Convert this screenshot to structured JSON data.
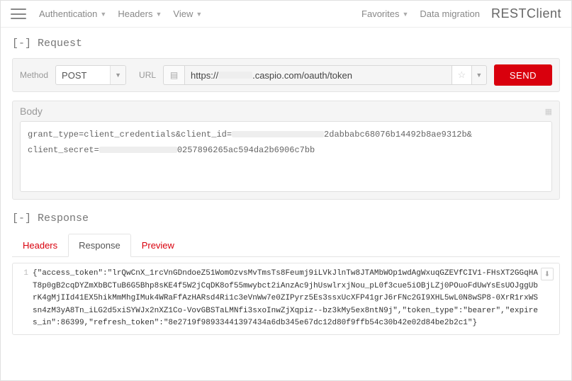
{
  "topbar": {
    "menu": {
      "auth": "Authentication",
      "headers": "Headers",
      "view": "View"
    },
    "favorites": "Favorites",
    "migration": "Data migration",
    "brand": "RESTClient"
  },
  "request": {
    "header": "[-] Request",
    "method_label": "Method",
    "method": "POST",
    "url_label": "URL",
    "url_prefix": "https://",
    "url_suffix": ".caspio.com/oauth/token",
    "send": "SEND"
  },
  "body": {
    "label": "Body",
    "line1a": "grant_type=client_credentials&client_id=",
    "line1b": "2dabbabc68076b14492b8ae9312b&",
    "line2a": "client_secret=",
    "line2b": "0257896265ac594da2b6906c7bb"
  },
  "response": {
    "header": "[-] Response",
    "tabs": {
      "headers": "Headers",
      "response": "Response",
      "preview": "Preview"
    },
    "line_no": "1",
    "body": "{\"access_token\":\"lrQwCnX_1rcVnGDndoeZ51WomOzvsMvTmsTs8Feumj9iLVkJlnTw8JTAMbWOp1wdAgWxuqGZEVfCIV1-FHsXT2GGqHAT8p0gB2cqDYZmXbBCTuB6G5Bhp8sKE4f5W2jCqDK8of55mwybct2iAnzAc9jhUswlrxjNou_pL0f3cue5iOBjLZj0POuoFdUwYsEsUOJggUbrK4gMjIId41EX5hikMmMhgIMuk4WRaFfAzHARsd4Ri1c3eVnWw7e0ZIPyrz5Es3ssxUcXFP41grJ6rFNc2GI9XHL5wL0N8wSP8-0XrR1rxWSsn4zM3yA8Tn_iLG2d5xiSYWJx2nXZ1Co-VovGBSTaLMNfi3sxoInwZjXqpiz--bz3kMy5ex8ntN9j\",\"token_type\":\"bearer\",\"expires_in\":86399,\"refresh_token\":\"8e2719f98933441397434a6db345e67dc12d80f9ffb54c30b42e02d84be2b2c1\"}"
  }
}
